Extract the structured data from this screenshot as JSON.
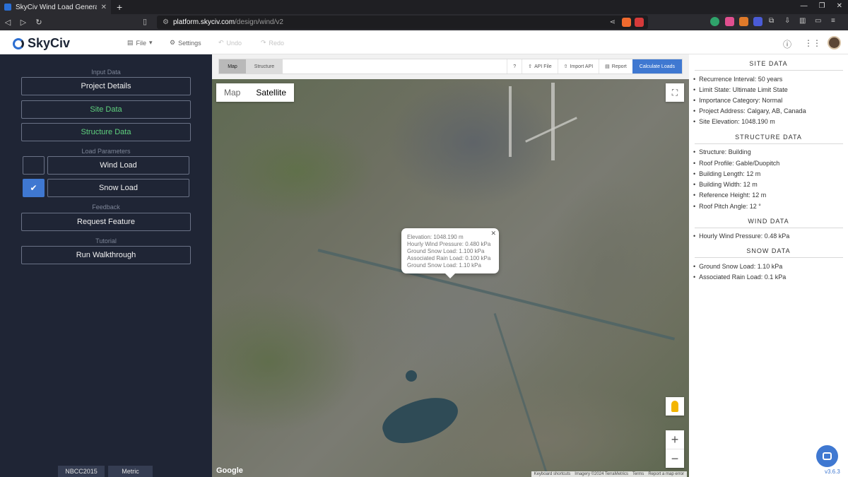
{
  "browser": {
    "tab_title": "SkyCiv Wind Load Generat",
    "url_domain": "platform.skyciv.com",
    "url_path": "/design/wind/v2"
  },
  "app": {
    "logo_text": "SkyCiv",
    "menu": {
      "file": "File",
      "settings": "Settings",
      "undo": "Undo",
      "redo": "Redo"
    }
  },
  "sidebar": {
    "input_data_heading": "Input Data",
    "project_details": "Project Details",
    "site_data": "Site Data",
    "structure_data": "Structure Data",
    "load_parameters_heading": "Load Parameters",
    "wind_load": "Wind Load",
    "wind_checked": false,
    "snow_load": "Snow Load",
    "snow_checked": true,
    "feedback_heading": "Feedback",
    "request_feature": "Request Feature",
    "tutorial_heading": "Tutorial",
    "run_walkthrough": "Run Walkthrough",
    "code_tag": "NBCC2015",
    "unit_tag": "Metric"
  },
  "map_toolbar": {
    "tab_map": "Map",
    "tab_structure": "Structure",
    "help": "?",
    "api_file": "API File",
    "import_api": "Import API",
    "report": "Report",
    "calculate": "Calculate Loads"
  },
  "map": {
    "type_map": "Map",
    "type_satellite": "Satellite",
    "google": "Google",
    "attribution": [
      "Keyboard shortcuts",
      "Imagery ©2024 TerraMetrics",
      "Terms",
      "Report a map error"
    ],
    "popup": [
      "Elevation: 1048.190 m",
      "Hourly Wind Pressure: 0.480 kPa",
      "Ground Snow Load: 1.100 kPa",
      "Associated Rain Load: 0.100 kPa",
      "Ground Snow Load: 1.10 kPa"
    ]
  },
  "panel": {
    "site_heading": "SITE DATA",
    "site_items": [
      "Recurrence Interval: 50 years",
      "Limit State: Ultimate Limit State",
      "Importance Category: Normal",
      "Project Address: Calgary, AB, Canada",
      "Site Elevation: 1048.190 m"
    ],
    "structure_heading": "STRUCTURE DATA",
    "structure_items": [
      "Structure: Building",
      "Roof Profile: Gable/Duopitch",
      "Building Length: 12 m",
      "Building Width: 12 m",
      "Reference Height: 12 m",
      "Roof Pitch Angle: 12 °"
    ],
    "wind_heading": "WIND DATA",
    "wind_items": [
      "Hourly Wind Pressure: 0.48 kPa"
    ],
    "snow_heading": "SNOW DATA",
    "snow_items": [
      "Ground Snow Load: 1.10 kPa",
      "Associated Rain Load: 0.1 kPa"
    ],
    "version": "v3.6.3"
  },
  "colors": {
    "accent": "#3f78d1",
    "sidebar_bg": "#1f2535",
    "green": "#5fd17e"
  }
}
